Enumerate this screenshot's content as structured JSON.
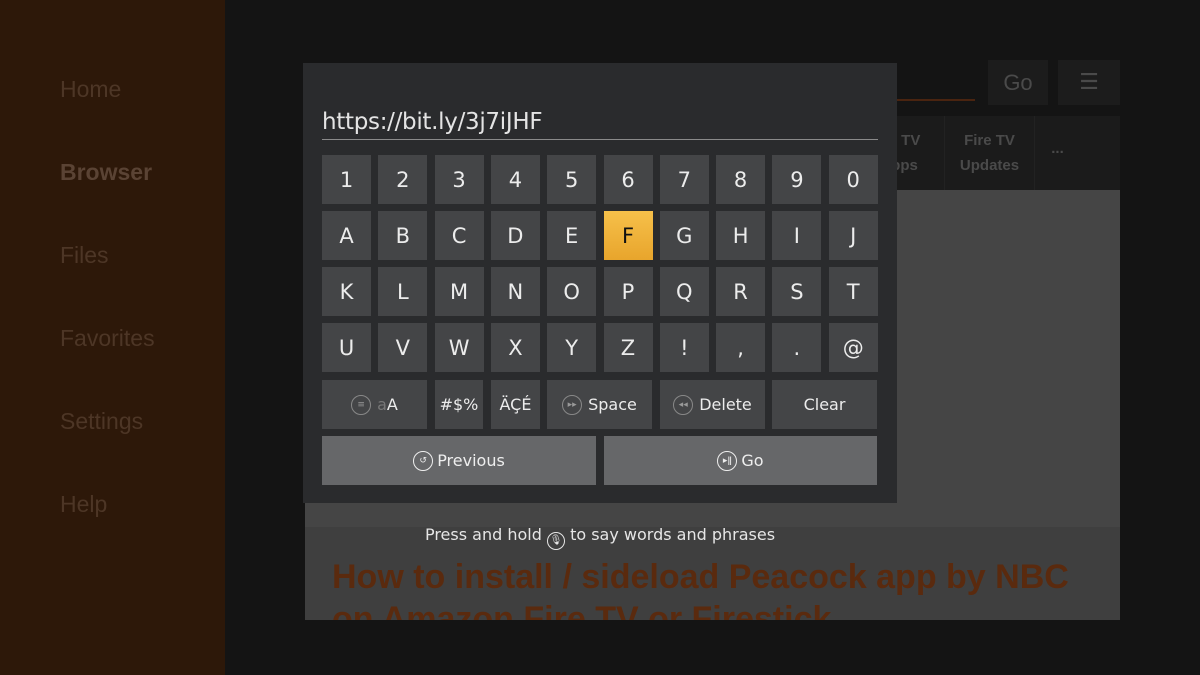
{
  "sidebar": {
    "items": [
      {
        "label": "Home"
      },
      {
        "label": "Browser",
        "active": true
      },
      {
        "label": "Files"
      },
      {
        "label": "Favorites"
      },
      {
        "label": "Settings"
      },
      {
        "label": "Help"
      }
    ]
  },
  "browser": {
    "go_label": "Go",
    "menu_icon": "hamburger-icon",
    "tabs": [
      {
        "line1": "e TV",
        "line2": "pps"
      },
      {
        "line1": "Fire TV",
        "line2": "Updates"
      },
      {
        "line1": "...",
        "line2": ""
      }
    ],
    "headline": "How to install / sideload Peacock app by NBC on Amazon Fire TV or Firestick"
  },
  "keyboard": {
    "url": "https://bit.ly/3j7iJHF",
    "selected_key": "F",
    "highlight_color": "#f0b43c",
    "rows": [
      [
        "1",
        "2",
        "3",
        "4",
        "5",
        "6",
        "7",
        "8",
        "9",
        "0"
      ],
      [
        "A",
        "B",
        "C",
        "D",
        "E",
        "F",
        "G",
        "H",
        "I",
        "J"
      ],
      [
        "K",
        "L",
        "M",
        "N",
        "O",
        "P",
        "Q",
        "R",
        "S",
        "T"
      ],
      [
        "U",
        "V",
        "W",
        "X",
        "Y",
        "Z",
        "!",
        ",",
        ".",
        "@"
      ]
    ],
    "case_label_lower": "a",
    "case_label_upper": "A",
    "symbols_label": "#$%",
    "accents_label": "ÄÇÉ",
    "space_label": "Space",
    "delete_label": "Delete",
    "clear_label": "Clear",
    "previous_label": "Previous",
    "go_label": "Go"
  },
  "hint": {
    "before": "Press and hold",
    "after": "to say words and phrases"
  }
}
